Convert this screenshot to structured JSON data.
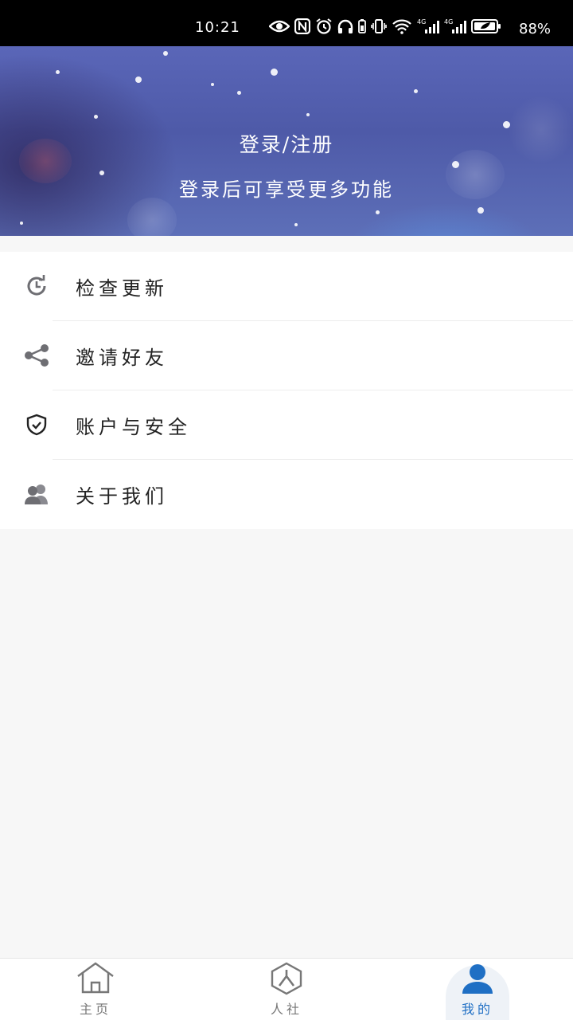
{
  "status_bar": {
    "time": "10:21",
    "battery": "88%",
    "network_label_1": "4G",
    "network_label_2": "4G"
  },
  "banner": {
    "title": "登录/注册",
    "subtitle": "登录后可享受更多功能"
  },
  "menu": {
    "items": [
      {
        "label": "检查更新",
        "icon": "refresh-clock-icon"
      },
      {
        "label": "邀请好友",
        "icon": "share-icon"
      },
      {
        "label": "账户与安全",
        "icon": "shield-check-icon"
      },
      {
        "label": "关于我们",
        "icon": "users-icon"
      }
    ]
  },
  "bottom_nav": {
    "items": [
      {
        "label": "主页",
        "icon": "home-icon"
      },
      {
        "label": "人社",
        "icon": "person-hexagon-icon"
      },
      {
        "label": "我的",
        "icon": "user-icon",
        "active": true
      }
    ]
  },
  "colors": {
    "accent": "#1f6fc4",
    "icon_gray": "#6e6e73",
    "banner": "#5a66b8"
  }
}
